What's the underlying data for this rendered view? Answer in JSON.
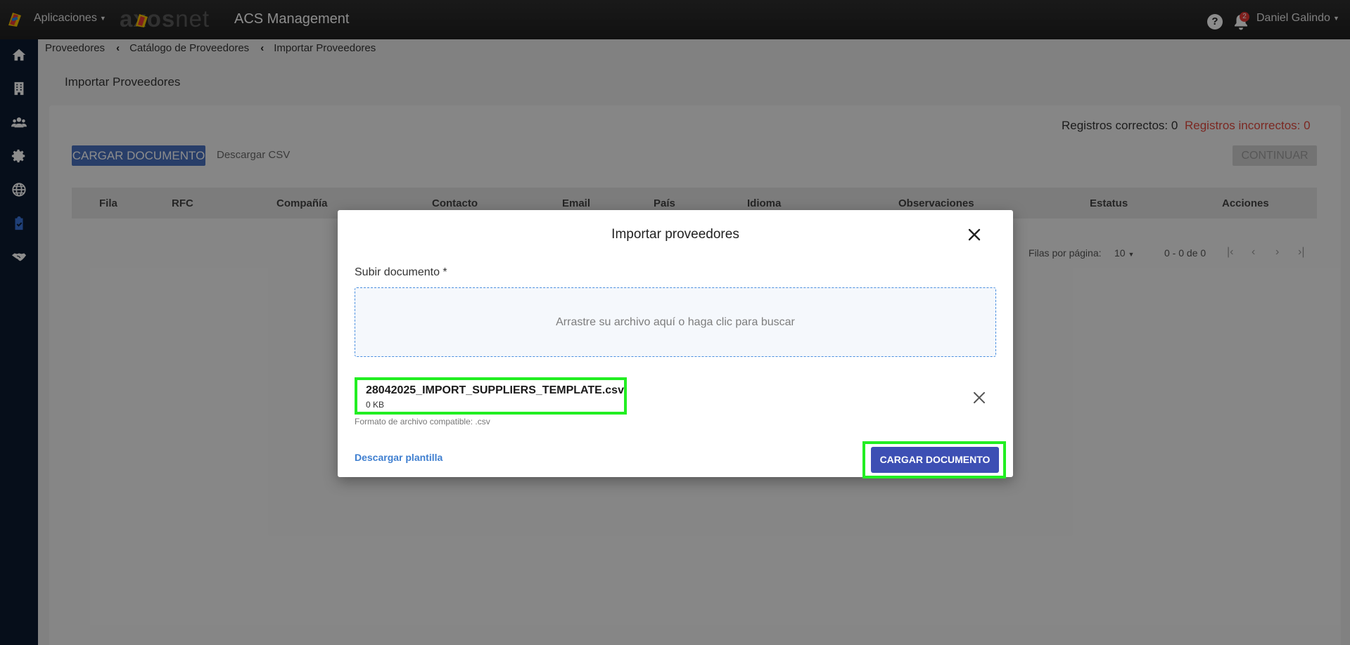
{
  "header": {
    "apps_label": "Aplicaciones",
    "brand_bold": "axos",
    "brand_light": "net",
    "title": "ACS Management",
    "notification_count": "2",
    "help_glyph": "?",
    "user_name": "Daniel Galindo"
  },
  "sidebar": {
    "items": [
      "home-icon",
      "building-icon",
      "users-icon",
      "gear-icon",
      "globe-icon",
      "clipboard-check-icon",
      "handshake-icon"
    ],
    "active_index": 5
  },
  "breadcrumb": [
    "Proveedores",
    "Catálogo de Proveedores",
    "Importar Proveedores"
  ],
  "page": {
    "title": "Importar Proveedores",
    "correct_records": "Registros correctos: 0",
    "incorrect_records": "Registros incorrectos: 0",
    "upload_button": "CARGAR DOCUMENTO",
    "download_csv": "Descargar CSV",
    "continue_button": "CONTINUAR",
    "columns": [
      "Fila",
      "RFC",
      "Compañía",
      "Contacto",
      "Email",
      "País",
      "Idioma",
      "Observaciones",
      "Estatus",
      "Acciones"
    ],
    "pager": {
      "rows_label": "Filas por página:",
      "rows_value": "10",
      "range": "0 - 0 de 0"
    }
  },
  "modal": {
    "title": "Importar proveedores",
    "field_label": "Subir documento *",
    "dropzone_text": "Arrastre su archivo aquí o haga clic para buscar",
    "file_name": "28042025_IMPORT_SUPPLIERS_TEMPLATE.csv",
    "file_size": "0 KB",
    "format_note": "Formato de archivo compatible: .csv",
    "download_template": "Descargar plantilla",
    "submit_button": "CARGAR DOCUMENTO"
  },
  "colors": {
    "accent": "#3d4fb4",
    "highlight": "#22ee22",
    "error": "#e0493e",
    "sidebar": "#0b1a30"
  }
}
